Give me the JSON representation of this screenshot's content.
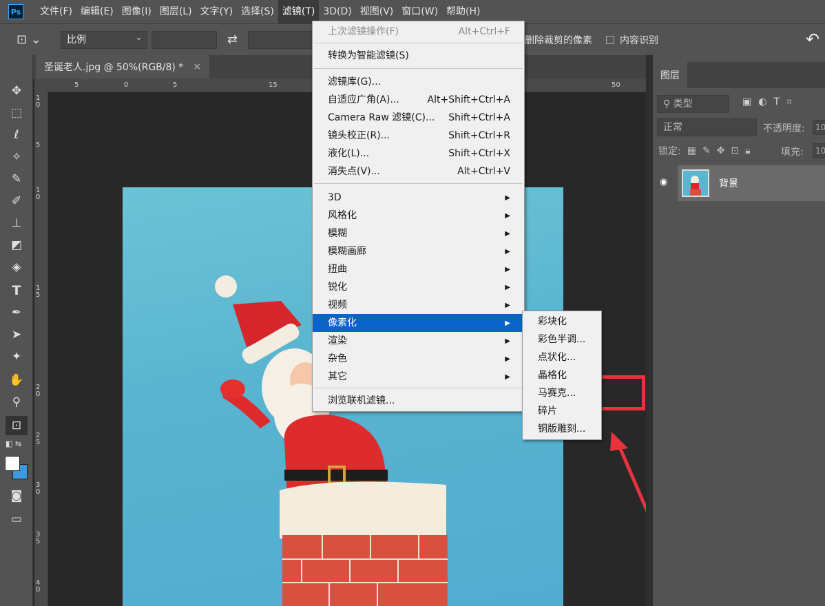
{
  "menubar": {
    "logo": "Ps",
    "items": [
      {
        "label": "文件(F)"
      },
      {
        "label": "编辑(E)"
      },
      {
        "label": "图像(I)"
      },
      {
        "label": "图层(L)"
      },
      {
        "label": "文字(Y)"
      },
      {
        "label": "选择(S)"
      },
      {
        "label": "滤镜(T)"
      },
      {
        "label": "3D(D)"
      },
      {
        "label": "视图(V)"
      },
      {
        "label": "窗口(W)"
      },
      {
        "label": "帮助(H)"
      }
    ],
    "active": "滤镜(T)"
  },
  "options_bar": {
    "ratio": "比例",
    "delete_cropped": "删除裁剪的像素",
    "content_aware": "内容识别"
  },
  "document": {
    "tab_title": "圣诞老人.jpg @ 50%(RGB/8) *",
    "close": "×"
  },
  "rulers": {
    "top_labels": [
      "5",
      "0",
      "5",
      "15",
      "50"
    ],
    "left_labels": [
      "1\n0",
      "5",
      "1\n0",
      "1\n5",
      "2\n0",
      "2\n5",
      "3\n0",
      "3\n5",
      "4\n0"
    ]
  },
  "filter_menu": {
    "last_filter": {
      "label": "上次滤镜操作(F)",
      "shortcut": "Alt+Ctrl+F"
    },
    "smart_filter": {
      "label": "转换为智能滤镜(S)"
    },
    "items_group1": [
      {
        "label": "滤镜库(G)...",
        "shortcut": ""
      },
      {
        "label": "自适应广角(A)...",
        "shortcut": "Alt+Shift+Ctrl+A"
      },
      {
        "label": "Camera Raw 滤镜(C)...",
        "shortcut": "Shift+Ctrl+A"
      },
      {
        "label": "镜头校正(R)...",
        "shortcut": "Shift+Ctrl+R"
      },
      {
        "label": "液化(L)...",
        "shortcut": "Shift+Ctrl+X"
      },
      {
        "label": "消失点(V)...",
        "shortcut": "Alt+Ctrl+V"
      }
    ],
    "items_group2": [
      {
        "label": "3D"
      },
      {
        "label": "风格化"
      },
      {
        "label": "模糊"
      },
      {
        "label": "模糊画廊"
      },
      {
        "label": "扭曲"
      },
      {
        "label": "锐化"
      },
      {
        "label": "视频"
      },
      {
        "label": "像素化"
      },
      {
        "label": "渲染"
      },
      {
        "label": "杂色"
      },
      {
        "label": "其它"
      }
    ],
    "highlighted": "像素化",
    "browse_online": {
      "label": "浏览联机滤镜..."
    }
  },
  "pixelate_submenu": {
    "items": [
      {
        "label": "彩块化"
      },
      {
        "label": "彩色半调..."
      },
      {
        "label": "点状化..."
      },
      {
        "label": "晶格化"
      },
      {
        "label": "马赛克..."
      },
      {
        "label": "碎片"
      },
      {
        "label": "铜版雕刻..."
      }
    ],
    "emphasized": "马赛克..."
  },
  "layers_panel": {
    "tab": "图层",
    "kind_filter": "类型",
    "blend_mode": "正常",
    "opacity_label": "不透明度:",
    "opacity_value": "10",
    "lock_label": "锁定:",
    "fill_label": "填充:",
    "fill_value": "10",
    "layer_name": "背景"
  },
  "colors": {
    "accent": "#0a64c8",
    "annotation": "#e8333f",
    "foreground": "#ffffff",
    "background": "#3a9be0"
  },
  "icons": [
    "move-icon",
    "marquee-icon",
    "lasso-icon",
    "magic-wand-icon",
    "eyedropper-icon",
    "brush-icon",
    "stamp-icon",
    "eraser-icon",
    "paint-bucket-icon",
    "type-icon",
    "pen-icon",
    "path-select-icon",
    "shape-icon",
    "hand-icon",
    "zoom-icon",
    "crop-icon",
    "quick-mask-icon",
    "screen-mode-icon"
  ]
}
